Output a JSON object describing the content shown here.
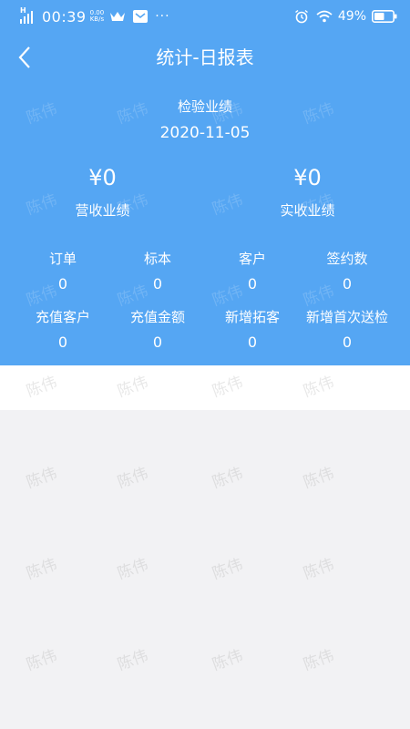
{
  "status_bar": {
    "signal_label": "H",
    "time": "00:39",
    "speed_value": "0.00",
    "speed_unit": "KB/s",
    "more": "···",
    "battery_percent": "49%",
    "icons": [
      "crown-icon",
      "mail-icon",
      "alarm-icon",
      "wifi-icon",
      "battery-icon"
    ]
  },
  "nav": {
    "back_icon": "chevron-left-icon",
    "title": "统计-日报表"
  },
  "section": {
    "label": "检验业绩",
    "date": "2020-11-05"
  },
  "kpis": [
    {
      "value": "¥0",
      "label": "营收业绩"
    },
    {
      "value": "¥0",
      "label": "实收业绩"
    }
  ],
  "stats_row1": [
    {
      "label": "订单",
      "value": "0"
    },
    {
      "label": "标本",
      "value": "0"
    },
    {
      "label": "客户",
      "value": "0"
    },
    {
      "label": "签约数",
      "value": "0"
    }
  ],
  "stats_row2": [
    {
      "label": "充值客户",
      "value": "0"
    },
    {
      "label": "充值金额",
      "value": "0"
    },
    {
      "label": "新增拓客",
      "value": "0"
    },
    {
      "label": "新增首次送检",
      "value": "0"
    }
  ],
  "watermark": {
    "text": "陈伟"
  },
  "colors": {
    "primary": "#55a6f3",
    "white": "#ffffff",
    "background": "#f2f2f4"
  }
}
